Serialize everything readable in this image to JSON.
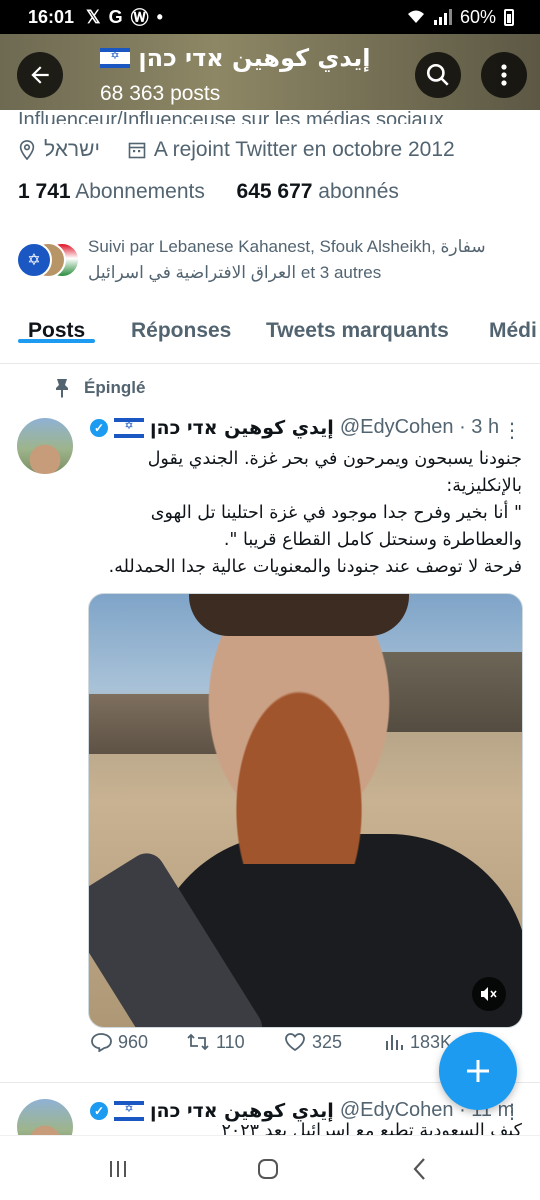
{
  "status_bar": {
    "time": "16:01",
    "notif_x": "𝕏",
    "notif_g": "G",
    "notif_wa": "Ⓦ",
    "dot": "•",
    "signal": "📶",
    "battery": "60%"
  },
  "header": {
    "display_name": "إيدي كوهين אדי כהן",
    "posts_count": "68 363 posts"
  },
  "profile": {
    "category_line": "Influenceur/Influenceuse sur les médias sociaux",
    "location": "ישראל",
    "joined": "A rejoint Twitter en octobre 2012",
    "following_count": "1 741",
    "following_label": "Abonnements",
    "followers_count": "645 677",
    "followers_label": "abonnés",
    "followed_by": "Suivi par Lebanese Kahanest, Sfouk Alsheikh, سفارة العراق الافتراضية في اسرائيل et 3 autres"
  },
  "tabs": [
    {
      "label": "Posts"
    },
    {
      "label": "Réponses"
    },
    {
      "label": "Tweets marquants"
    },
    {
      "label": "Médi"
    }
  ],
  "pinned_tweet": {
    "pinned_label": "Épinglé",
    "name": "إيدي كوهين אדי כהן",
    "handle_time": "@EdyCohen · 3 h",
    "text": "جنودنا يسبحون ويمرحون في بحر غزة. الجندي يقول بالإنكليزية:\n\" أنا بخير وفرح جدا  موجود في غزة احتلينا تل الهوى والعطاطرة  وسنحتل كامل القطاع قريبا \".\nفرحة لا توصف عند جنودنا والمعنويات عالية جدا الحمدلله.",
    "replies": "960",
    "retweets": "110",
    "likes": "325",
    "views": "183K"
  },
  "next_tweet": {
    "name": "إيدي كوهين אדי כהן",
    "handle_time": "@EdyCohen · 11 m",
    "text_fragment": "كيف السعودية تطبع مع اسرائيل بعد ٢٠٢٣"
  },
  "colors": {
    "accent": "#1d9bf0",
    "text_primary": "#0f1419",
    "text_secondary": "#536471"
  }
}
